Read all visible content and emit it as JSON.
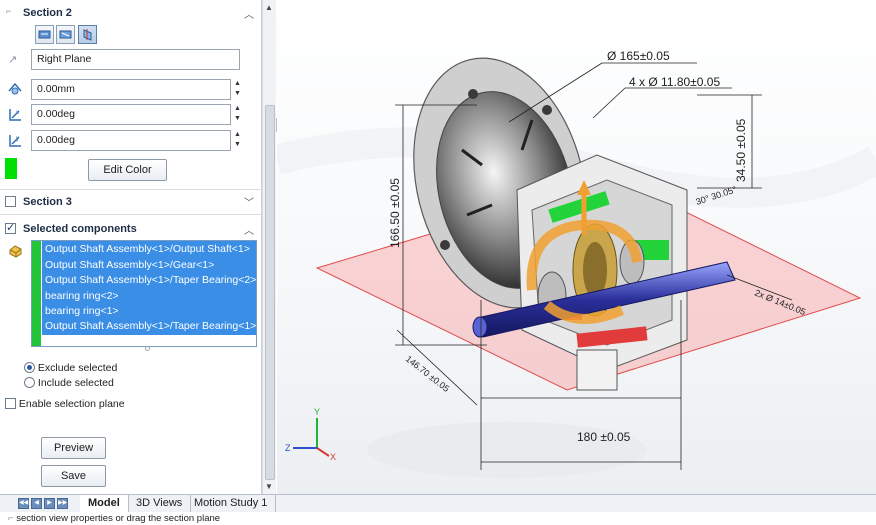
{
  "section2": {
    "title": "Section 2",
    "plane": "Right Plane",
    "offset": "0.00mm",
    "rot_x": "0.00deg",
    "rot_y": "0.00deg",
    "edit_color": "Edit Color",
    "color": "#00e000"
  },
  "section3": {
    "title": "Section 3"
  },
  "selected_components": {
    "title": "Selected components",
    "items": [
      "Output Shaft Assembly<1>/Output Shaft<1>",
      "Output Shaft Assembly<1>/Gear<1>",
      "Output Shaft Assembly<1>/Taper Bearing<2>",
      "bearing ring<2>",
      "bearing ring<1>",
      "Output Shaft Assembly<1>/Taper Bearing<1>"
    ],
    "exclude_label": "Exclude selected",
    "include_label": "Include selected",
    "exclude_selected": true
  },
  "enable_plane_label": "Enable selection plane",
  "buttons": {
    "preview": "Preview",
    "save": "Save"
  },
  "tabs": [
    "Model",
    "3D Views",
    "Motion Study 1"
  ],
  "active_tab": "Model",
  "status_text": "section view properties or drag the section plane",
  "dimensions": {
    "d165": "165±0.05",
    "d1180": "11.80±0.05",
    "d1180_prefix": "4 x",
    "d3450": "34.50 ±0.05",
    "d16650": "166.50 ±0.05",
    "d30": "30° 30.05°",
    "d1460": "2x Ø 14±0.05",
    "d14670": "146.70 ±0.05",
    "d180": "180 ±0.05"
  },
  "triad": {
    "x": "X",
    "y": "Y",
    "z": "Z"
  }
}
